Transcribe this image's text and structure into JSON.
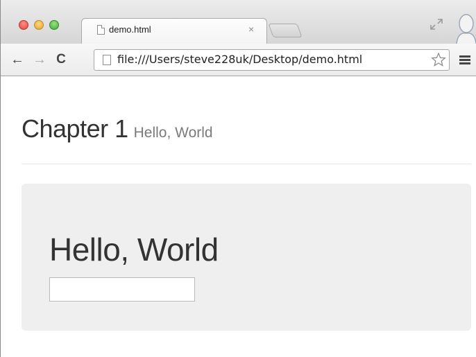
{
  "browser": {
    "tab": {
      "title": "demo.html",
      "close_glyph": "×",
      "icon": "document-icon"
    },
    "toolbar": {
      "back_glyph": "←",
      "forward_glyph": "→",
      "reload_glyph": "C",
      "url": "file:///Users/steve228uk/Desktop/demo.html",
      "url_icon": "document-icon"
    },
    "icons": [
      "close-window-icon",
      "minimize-window-icon",
      "maximize-window-icon",
      "fullscreen-icon",
      "profile-icon",
      "bookmark-star-icon",
      "menu-icon"
    ]
  },
  "page": {
    "header": {
      "title": "Chapter 1",
      "subtitle": "Hello, World"
    },
    "jumbotron": {
      "heading": "Hello, World",
      "input_value": ""
    }
  },
  "colors": {
    "traffic_close": "#e0443e",
    "traffic_min": "#dea236",
    "traffic_max": "#3fa93a",
    "title_text": "#333333",
    "subtitle_text": "#7a7a7a",
    "jumbotron_bg": "#efefef"
  }
}
